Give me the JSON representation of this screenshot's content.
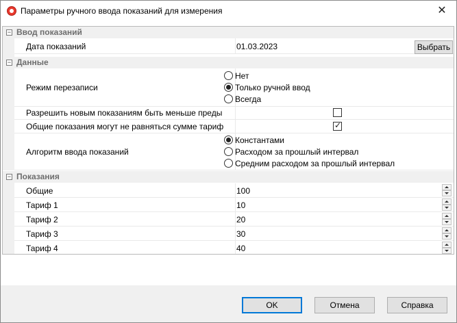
{
  "window": {
    "title": "Параметры ручного ввода показаний для измерения",
    "close_glyph": "✕"
  },
  "sections": {
    "input": {
      "toggle": "−",
      "label": "Ввод показаний"
    },
    "data": {
      "toggle": "−",
      "label": "Данные"
    },
    "readings": {
      "toggle": "−",
      "label": "Показания"
    }
  },
  "input": {
    "date_label": "Дата показаний",
    "date_value": "01.03.2023",
    "pick_button": "Выбрать"
  },
  "data": {
    "overwrite_label": "Режим перезаписи",
    "overwrite_options": [
      {
        "label": "Нет",
        "selected": false
      },
      {
        "label": "Только ручной ввод",
        "selected": true
      },
      {
        "label": "Всегда",
        "selected": false
      }
    ],
    "allow_less_label": "Разрешить новым показаниям быть меньше преды",
    "allow_less_checked": false,
    "total_mismatch_label": "Общие показания могут не равняться сумме тариф",
    "total_mismatch_checked": true,
    "checkmark_glyph": "✓",
    "algorithm_label": "Алгоритм ввода показаний",
    "algorithm_options": [
      {
        "label": "Константами",
        "selected": true
      },
      {
        "label": "Расходом за прошлый интервал",
        "selected": false
      },
      {
        "label": "Средним расходом за прошлый интервал",
        "selected": false
      }
    ]
  },
  "readings": [
    {
      "label": "Общие",
      "value": "100"
    },
    {
      "label": "Тариф 1",
      "value": "10"
    },
    {
      "label": "Тариф 2",
      "value": "20"
    },
    {
      "label": "Тариф 3",
      "value": "30"
    },
    {
      "label": "Тариф 4",
      "value": "40"
    }
  ],
  "buttons": {
    "ok": "OK",
    "cancel": "Отмена",
    "help": "Справка"
  }
}
